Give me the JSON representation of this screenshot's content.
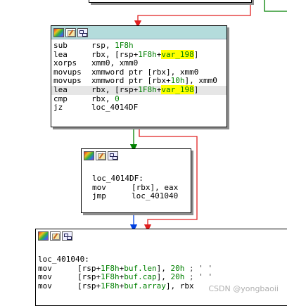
{
  "block1": {
    "rows": [
      {
        "mnem": "sub",
        "parts": [
          {
            "t": "rsp, "
          },
          {
            "t": "1F8h",
            "c": "grn"
          }
        ]
      },
      {
        "mnem": "lea",
        "parts": [
          {
            "t": "rbx, [rsp+"
          },
          {
            "t": "1F8h",
            "c": "grn"
          },
          {
            "t": "+"
          },
          {
            "t": "var_198",
            "c": "yel"
          },
          {
            "t": "]"
          }
        ]
      },
      {
        "mnem": "xorps",
        "parts": [
          {
            "t": "xmm0, xmm0"
          }
        ]
      },
      {
        "mnem": "movups",
        "parts": [
          {
            "t": "xmmword ptr [rbx], xmm0"
          }
        ]
      },
      {
        "mnem": "movups",
        "parts": [
          {
            "t": "xmmword ptr [rbx+"
          },
          {
            "t": "10h",
            "c": "grn"
          },
          {
            "t": "], xmm0"
          }
        ]
      },
      {
        "mnem": "lea",
        "hl": true,
        "parts": [
          {
            "t": "rbx, [rsp+"
          },
          {
            "t": "1F8h",
            "c": "grn"
          },
          {
            "t": "+"
          },
          {
            "t": "var_198",
            "c": "yel"
          },
          {
            "t": "]"
          }
        ]
      },
      {
        "mnem": "cmp",
        "parts": [
          {
            "t": "rbx, "
          },
          {
            "t": "0",
            "c": "grn"
          }
        ]
      },
      {
        "mnem": "jz",
        "parts": [
          {
            "t": "loc_4014DF"
          }
        ]
      }
    ]
  },
  "block2": {
    "label": "loc_4014DF:",
    "rows": [
      {
        "mnem": "mov",
        "parts": [
          {
            "t": "[rbx], eax"
          }
        ]
      },
      {
        "mnem": "jmp",
        "parts": [
          {
            "t": "loc_401040"
          }
        ]
      }
    ]
  },
  "block3": {
    "label": "loc_401040:",
    "rows": [
      {
        "mnem": "mov",
        "parts": [
          {
            "t": "[rsp+"
          },
          {
            "t": "1F8h",
            "c": "grn"
          },
          {
            "t": "+"
          },
          {
            "t": "buf.len",
            "c": "grn"
          },
          {
            "t": "], "
          },
          {
            "t": "20h",
            "c": "grn"
          },
          {
            "t": " ; ' '",
            "c": "cmt"
          }
        ]
      },
      {
        "mnem": "mov",
        "parts": [
          {
            "t": "[rsp+"
          },
          {
            "t": "1F8h",
            "c": "grn"
          },
          {
            "t": "+"
          },
          {
            "t": "buf.cap",
            "c": "grn"
          },
          {
            "t": "], "
          },
          {
            "t": "20h",
            "c": "grn"
          },
          {
            "t": " ; ' '",
            "c": "cmt"
          }
        ]
      },
      {
        "mnem": "mov",
        "parts": [
          {
            "t": "[rsp+"
          },
          {
            "t": "1F8h",
            "c": "grn"
          },
          {
            "t": "+"
          },
          {
            "t": "buf.array",
            "c": "grn"
          },
          {
            "t": "], rbx"
          }
        ]
      }
    ]
  },
  "watermark": "CSDN @yongbaoii",
  "colors": {
    "header": "#b4dcdc",
    "edge_true": "#008000",
    "edge_false": "#e02020",
    "edge_jump": "#0040e0"
  }
}
